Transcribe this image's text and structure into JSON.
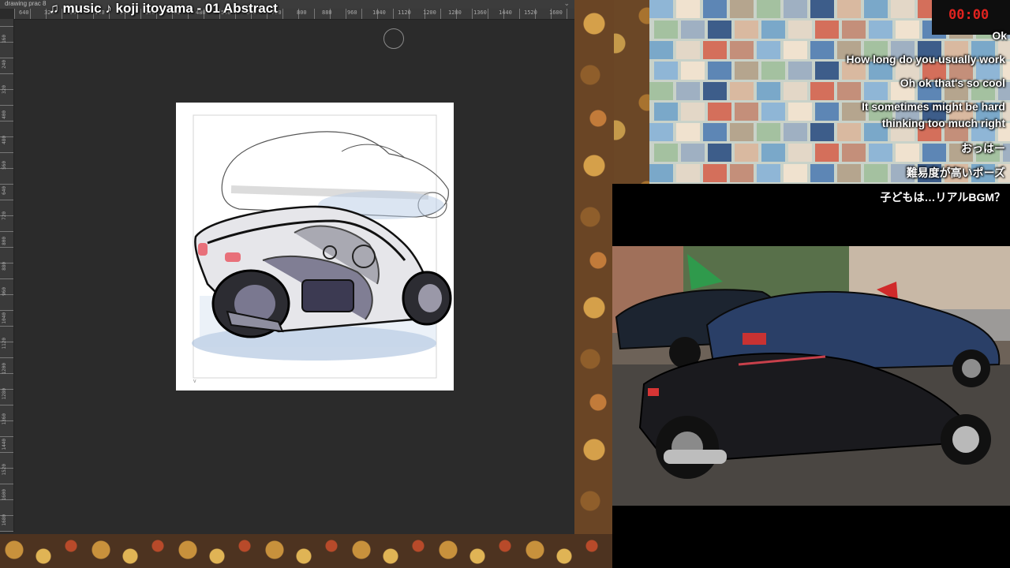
{
  "document_tab": {
    "name": "drawing prac 8"
  },
  "music_overlay": "♫ music ♪ koji itoyama - 01 Abstract",
  "ruler": {
    "horizontal_labels": [
      "640",
      "320",
      "80",
      "160",
      "240",
      "320",
      "400",
      "480",
      "560",
      "640",
      "720",
      "800",
      "880",
      "960",
      "1040",
      "1120",
      "1200",
      "1280",
      "1360",
      "1440",
      "1520",
      "1600"
    ],
    "vertical_labels": [
      "160",
      "240",
      "320",
      "400",
      "480",
      "560",
      "640",
      "720",
      "800",
      "880",
      "960",
      "1040",
      "1120",
      "1200",
      "1280",
      "1360",
      "1440",
      "1520",
      "1600",
      "1680"
    ]
  },
  "timer": {
    "display": "00:00"
  },
  "chat": [
    "Ok",
    "How long do you usually work",
    "Oh ok that's so cool",
    "It sometimes might be hard",
    "thinking too much right",
    "おっはー",
    "難易度が高いポーズ",
    "子どもは…リアルBGM？"
  ],
  "colors": {
    "app_bg": "#2b2b2b",
    "ruler_bg": "#3a3a3a",
    "timer_red": "#e0231f",
    "sketch_accent": "#e8707a",
    "shadow_blue": "#9fb8d8"
  }
}
